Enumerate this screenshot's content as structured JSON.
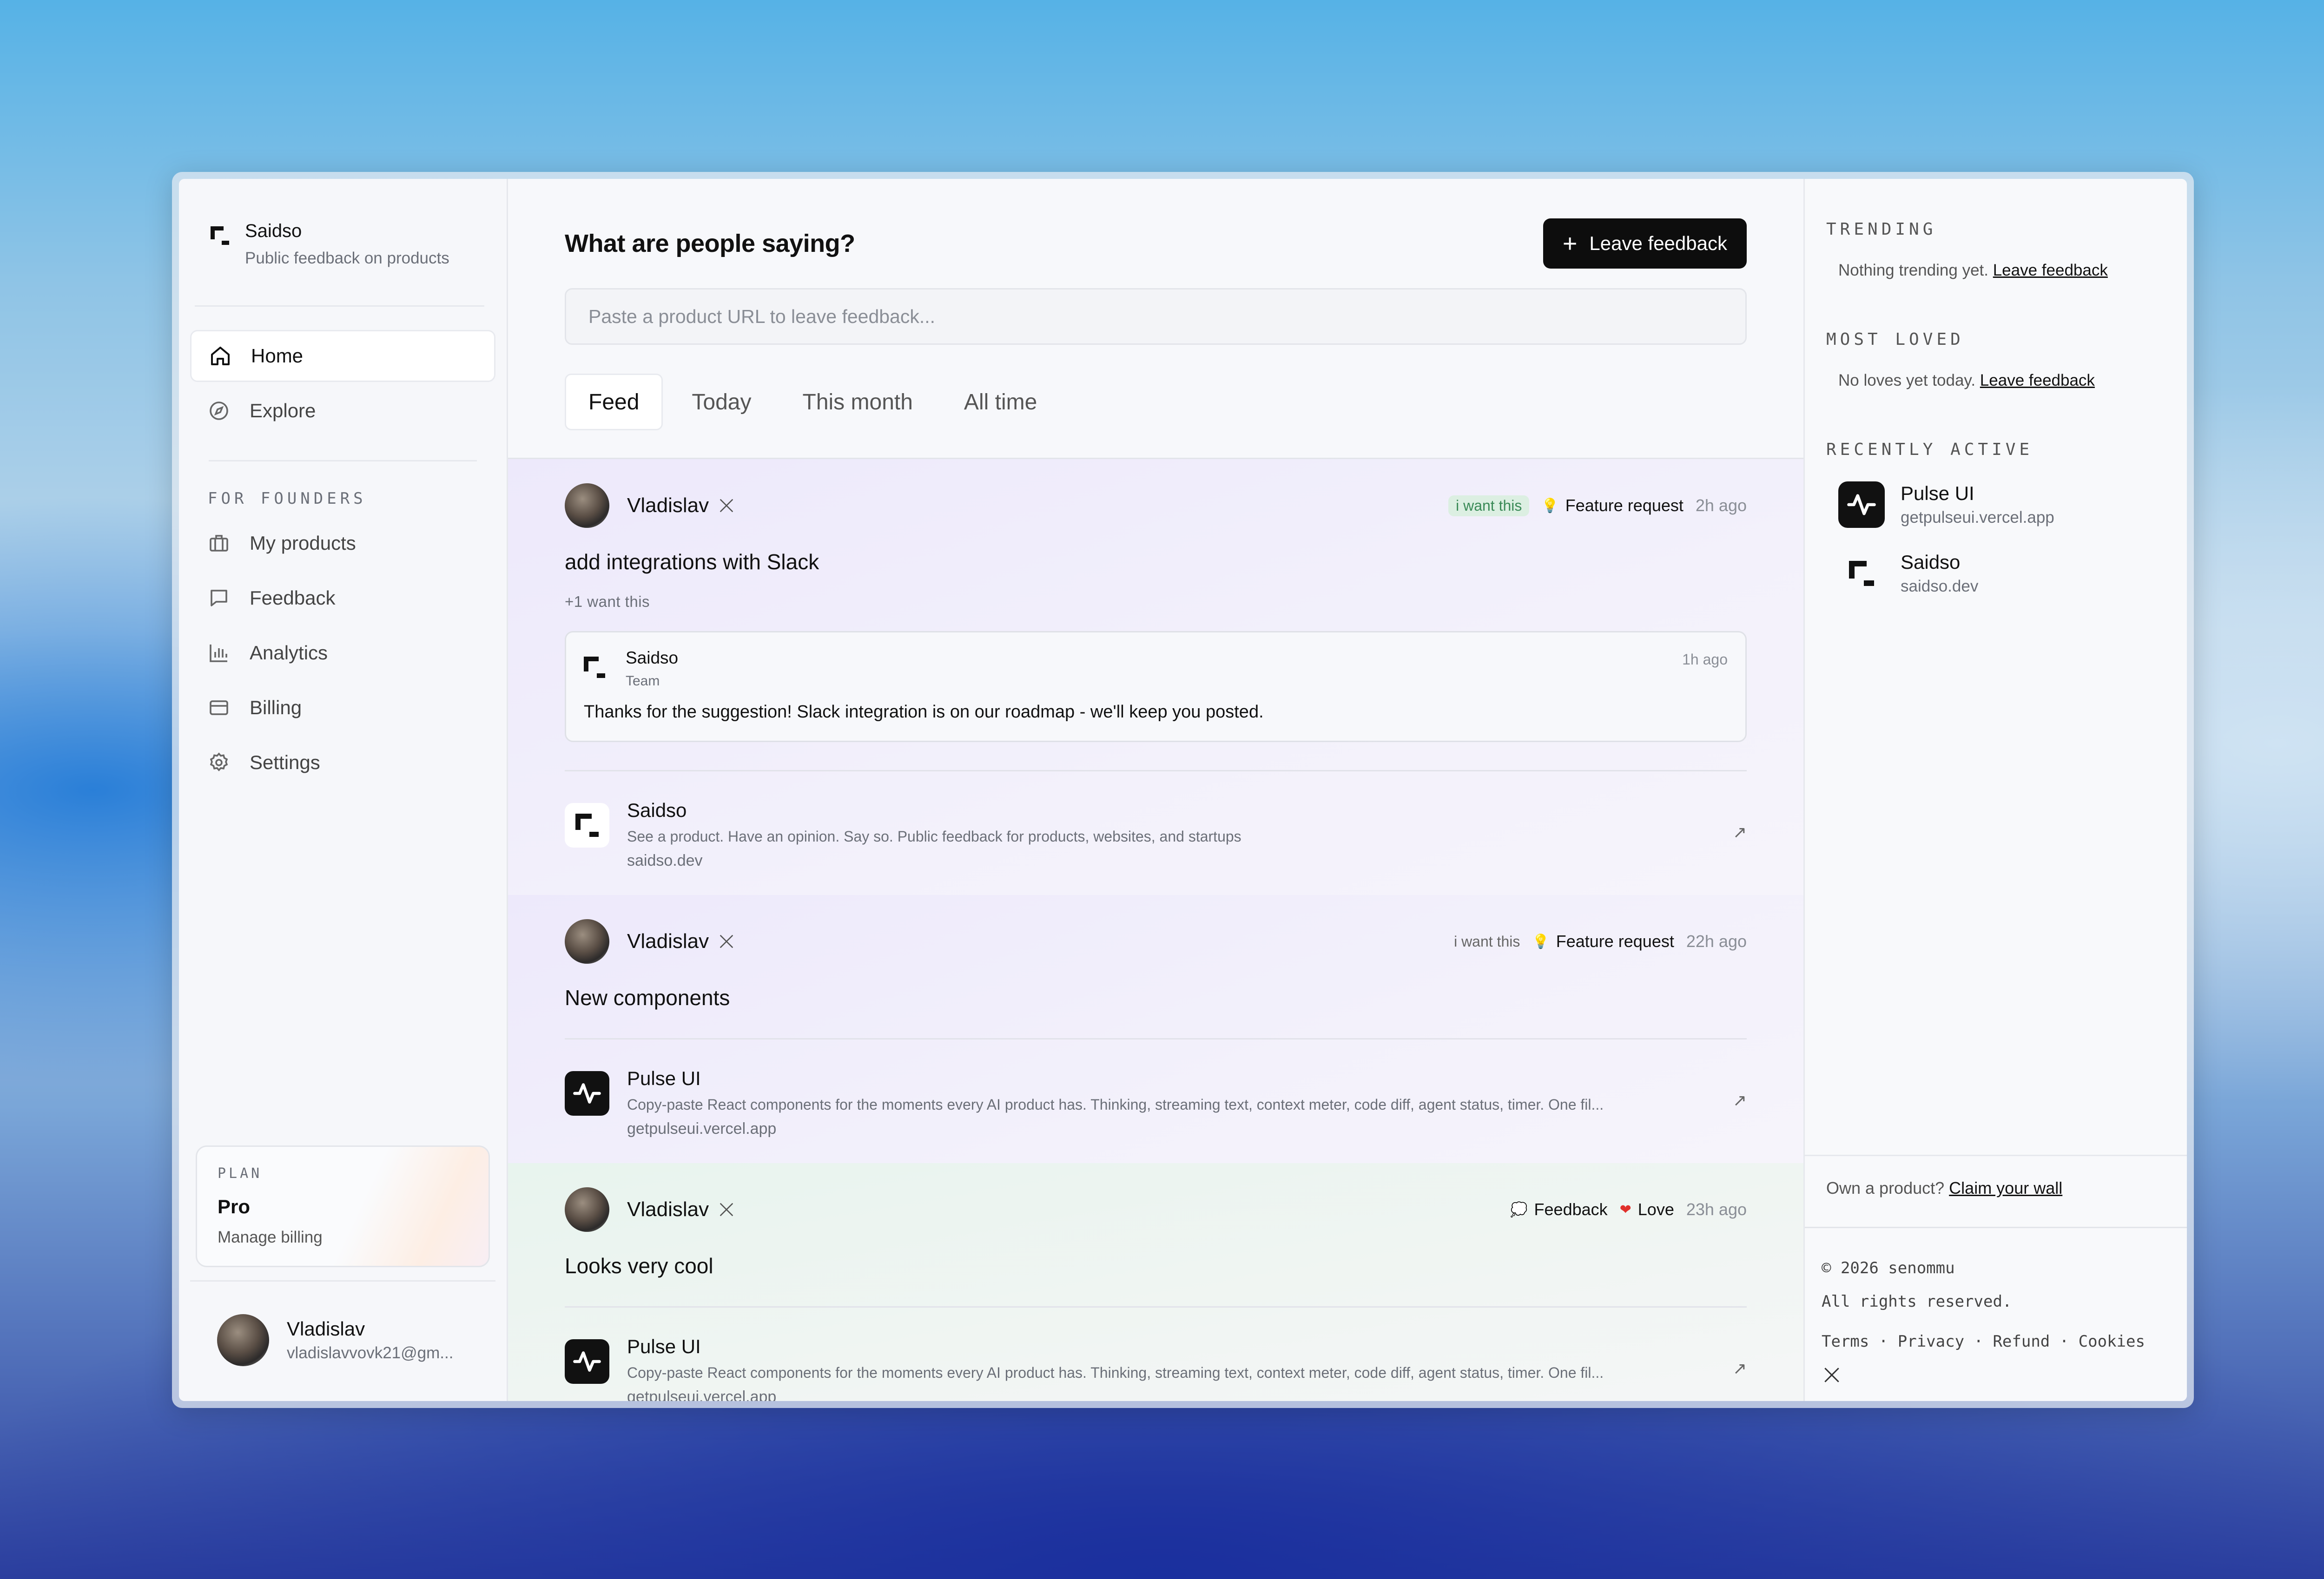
{
  "brand": {
    "name": "Saidso",
    "tagline": "Public feedback on products"
  },
  "sidebar": {
    "nav": [
      {
        "label": "Home",
        "icon": "home-icon",
        "active": true
      },
      {
        "label": "Explore",
        "icon": "compass-icon",
        "active": false
      }
    ],
    "founders_label": "FOR FOUNDERS",
    "founders": [
      {
        "label": "My products",
        "icon": "briefcase-icon"
      },
      {
        "label": "Feedback",
        "icon": "message-icon"
      },
      {
        "label": "Analytics",
        "icon": "bar-chart-icon"
      },
      {
        "label": "Billing",
        "icon": "credit-card-icon"
      },
      {
        "label": "Settings",
        "icon": "gear-icon"
      }
    ],
    "plan": {
      "label": "PLAN",
      "name": "Pro",
      "link": "Manage billing"
    },
    "user": {
      "name": "Vladislav",
      "email": "vladislavvovk21@gm..."
    }
  },
  "main": {
    "title": "What are people saying?",
    "leave_feedback": "Leave feedback",
    "url_placeholder": "Paste a product URL to leave feedback...",
    "tabs": [
      "Feed",
      "Today",
      "This month",
      "All time"
    ],
    "active_tab": "Feed"
  },
  "posts": [
    {
      "author": "Vladislav",
      "chip": "i want this",
      "category": "Feature request",
      "time": "2h ago",
      "text": "add integrations with Slack",
      "want_count": "+1 want this",
      "reply": {
        "author": "Saidso",
        "role": "Team",
        "time": "1h ago",
        "text": "Thanks for the suggestion! Slack integration is on our roadmap - we'll keep you posted."
      },
      "product": {
        "name": "Saidso",
        "desc": "See a product. Have an opinion. Say so. Public feedback for products, websites, and startups",
        "url": "saidso.dev"
      }
    },
    {
      "author": "Vladislav",
      "want": "i want this",
      "category": "Feature request",
      "time": "22h ago",
      "text": "New components",
      "product": {
        "name": "Pulse UI",
        "desc": "Copy-paste React components for the moments every AI product has. Thinking, streaming text, context meter, code diff, agent status, timer. One fil...",
        "url": "getpulseui.vercel.app"
      }
    },
    {
      "author": "Vladislav",
      "category": "Feedback",
      "reaction": "Love",
      "time": "23h ago",
      "text": "Looks very cool",
      "product": {
        "name": "Pulse UI",
        "desc": "Copy-paste React components for the moments every AI product has. Thinking, streaming text, context meter, code diff, agent status, timer. One fil...",
        "url": "getpulseui.vercel.app"
      }
    }
  ],
  "right": {
    "trending_label": "TRENDING",
    "trending_empty": "Nothing trending yet.",
    "trending_link": "Leave feedback",
    "loved_label": "MOST LOVED",
    "loved_empty": "No loves yet today.",
    "loved_link": "Leave feedback",
    "recent_label": "RECENTLY ACTIVE",
    "recent": [
      {
        "name": "Pulse UI",
        "url": "getpulseui.vercel.app"
      },
      {
        "name": "Saidso",
        "url": "saidso.dev"
      }
    ],
    "claim_text": "Own a product?",
    "claim_link": "Claim your wall",
    "copyright": "© 2026 senommu",
    "rights": "All rights reserved.",
    "links": "Terms · Privacy · Refund · Cookies"
  },
  "colors": {
    "accent": "#0d0d0d",
    "chip_green": "#dcefe2",
    "love_red": "#e0302b"
  }
}
